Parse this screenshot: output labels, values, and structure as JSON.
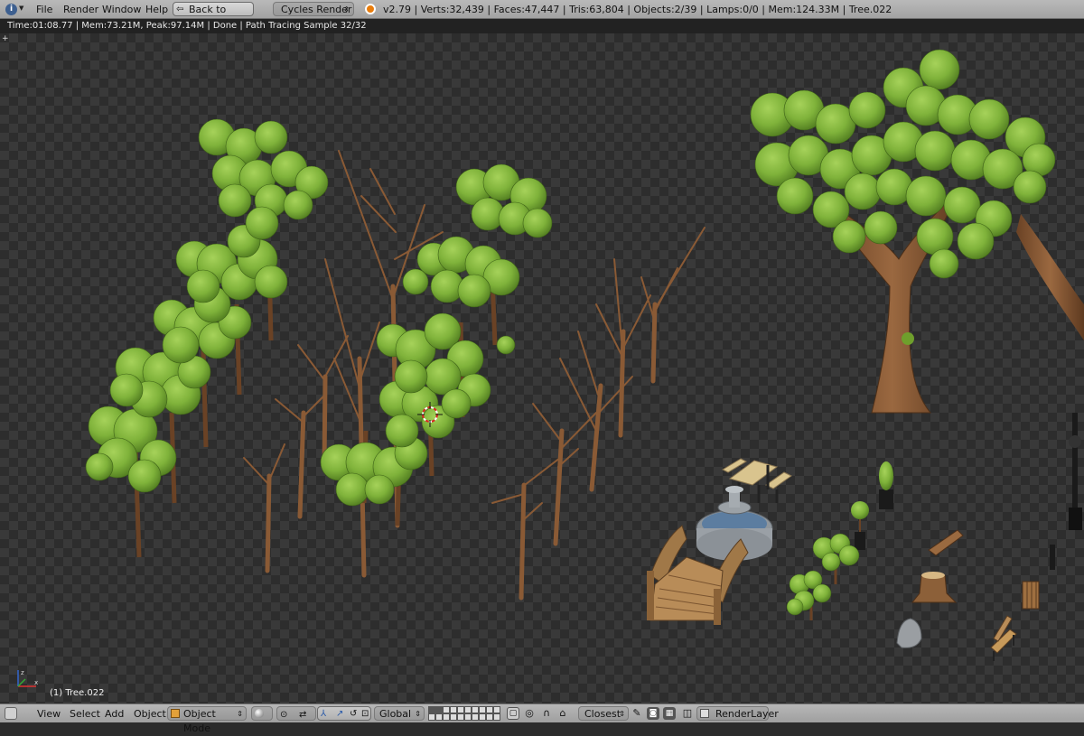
{
  "menu": {
    "file": "File",
    "render": "Render",
    "window": "Window",
    "help": "Help"
  },
  "back_button": "Back to Previous",
  "engine": "Cycles Render",
  "stats": "v2.79 | Verts:32,439 | Faces:47,447 | Tris:63,804 | Objects:2/39 | Lamps:0/0 | Mem:124.33M | Tree.022",
  "render_status": "Time:01:08.77 | Mem:73.21M, Peak:97.14M | Done | Path Tracing Sample 32/32",
  "viewport": {
    "object_label": "(1) Tree.022"
  },
  "bottom": {
    "view": "View",
    "select": "Select",
    "add": "Add",
    "object": "Object",
    "mode": "Object Mode",
    "orientation": "Global",
    "snap": "Closest",
    "render_layer": "RenderLayer"
  },
  "colors": {
    "leaf": "#7fb23a",
    "leaf_dark": "#4f7a1f",
    "bark": "#8a5a35",
    "bark_dark": "#5e3a20",
    "header": "#a8a8a8"
  }
}
